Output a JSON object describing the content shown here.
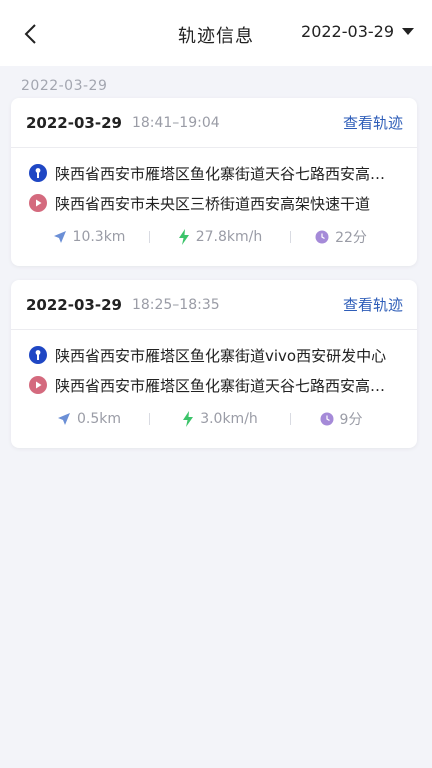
{
  "header": {
    "title": "轨迹信息",
    "date": "2022-03-29"
  },
  "groups": [
    {
      "date": "2022-03-29",
      "trips": [
        {
          "date": "2022-03-29",
          "time_range": "18:41–19:04",
          "link": "查看轨迹",
          "start_addr": "陕西省西安市雁塔区鱼化寨街道天谷七路西安高新区",
          "end_addr": "陕西省西安市未央区三桥街道西安高架快速干道",
          "distance": "10.3km",
          "speed": "27.8km/h",
          "duration": "22分"
        },
        {
          "date": "2022-03-29",
          "time_range": "18:25–18:35",
          "link": "查看轨迹",
          "start_addr": "陕西省西安市雁塔区鱼化寨街道vivo西安研发中心",
          "end_addr": "陕西省西安市雁塔区鱼化寨街道天谷七路西安高新区",
          "distance": "0.5km",
          "speed": "3.0km/h",
          "duration": "9分"
        }
      ]
    }
  ],
  "colors": {
    "start_dot": "#1f47c4",
    "end_dot": "#d46a7e",
    "link": "#2e5db8",
    "distance_icon": "#6b8fd6",
    "speed_icon": "#3cc46a",
    "duration_icon": "#a58ad8"
  },
  "icons": [
    "back-chevron-icon",
    "dropdown-triangle-icon",
    "start-point-icon",
    "end-point-icon",
    "navigation-arrow-icon",
    "lightning-icon",
    "clock-icon"
  ]
}
